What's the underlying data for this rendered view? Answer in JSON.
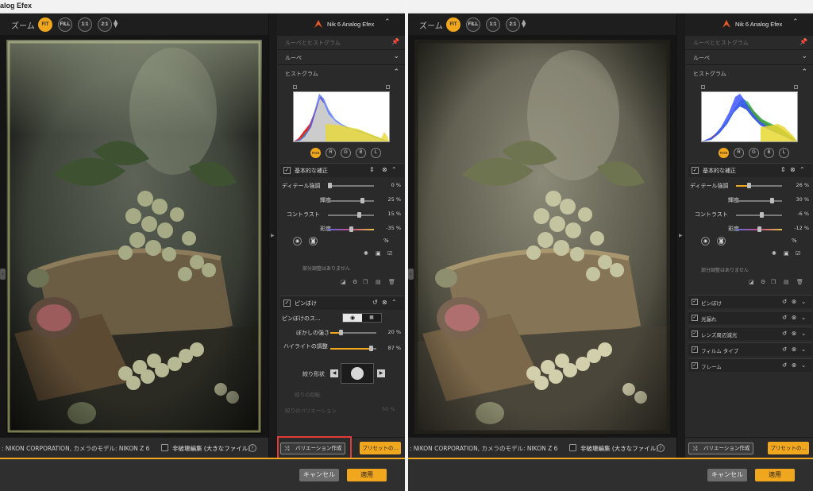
{
  "app": {
    "title": "alog Efex"
  },
  "zoom": {
    "label": "ズーム",
    "buttons": [
      "FIT",
      "FILL",
      "1:1",
      "2:1"
    ],
    "active": "FIT"
  },
  "brand": {
    "name": "Nik 6 Analog Efex",
    "color": "#f1a71d"
  },
  "panel": {
    "loupe_histogram": "ルーペとヒストグラム",
    "loupe": "ルーペ",
    "histogram": "ヒストグラム",
    "channels": [
      "RGB",
      "R",
      "G",
      "B",
      "L"
    ]
  },
  "left": {
    "basic": {
      "title": "基本的な補正",
      "rows": [
        {
          "label": "ディテール強調",
          "value": "0 %",
          "pos": 0.0
        },
        {
          "label": "輝度",
          "value": "25 %",
          "pos": 0.57
        },
        {
          "label": "コントラスト",
          "value": "15 %",
          "pos": 0.54
        },
        {
          "label": "彩度",
          "value": "-35 %",
          "pos": 0.45
        }
      ],
      "no_local": "部分調整はありません"
    },
    "vignette": {
      "title": "ピンぼけ",
      "mode_label": "ピンぼけのス...",
      "rows": [
        {
          "label": "ぼかしの強さ",
          "value": "20 %",
          "pos": 0.2
        },
        {
          "label": "ハイライトの調整",
          "value": "87 %",
          "pos": 0.87
        }
      ],
      "shape_label": "絞り形状",
      "dim1": "絞りの回転",
      "dim2": "絞りのバリエーション",
      "dim2_value": "50 %"
    }
  },
  "right": {
    "basic": {
      "title": "基本的な補正",
      "rows": [
        {
          "label": "ディテール強調",
          "value": "26 %",
          "pos": 0.26
        },
        {
          "label": "輝度",
          "value": "30 %",
          "pos": 0.6
        },
        {
          "label": "コントラスト",
          "value": "-6 %",
          "pos": 0.47
        },
        {
          "label": "彩度",
          "value": "-12 %",
          "pos": 0.44
        }
      ],
      "no_local": "部分調整はありません"
    },
    "filters": [
      "ピンぼけ",
      "光漏れ",
      "レンズ周辺減光",
      "フィルム タイプ",
      "フレーム"
    ]
  },
  "bottom": {
    "camera_info": ": NIKON CORPORATION, カメラのモデル: NIKON Z 6",
    "nondestructive": "非破壊編集 (大きなファイル)",
    "help": "?",
    "variation": "バリエーション作成",
    "preset": "プリセットの...",
    "cancel": "キャンセル",
    "apply": "適用"
  }
}
